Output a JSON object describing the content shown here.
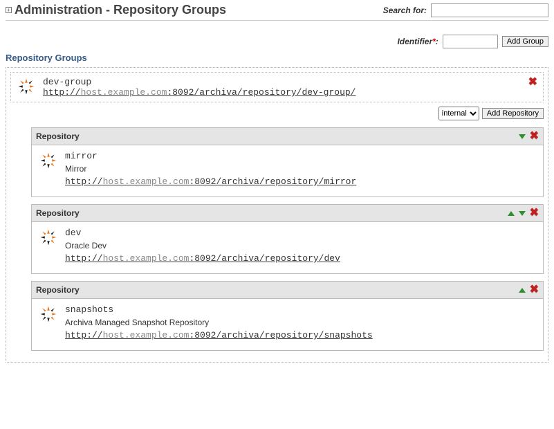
{
  "page": {
    "title": "Administration - Repository Groups",
    "search_label": "Search for:",
    "identifier_label": "Identifier",
    "add_group_btn": "Add Group",
    "section_title": "Repository Groups"
  },
  "group": {
    "id": "dev-group",
    "url_prefix": "http://",
    "url_host": "host.example.com",
    "url_suffix": ":8092/archiva/repository/dev-group/",
    "repo_select_value": "internal",
    "add_repo_btn": "Add Repository"
  },
  "repositories": [
    {
      "heading": "Repository",
      "id": "mirror",
      "name": "Mirror",
      "url_prefix": "http://",
      "url_host": "host.example.com",
      "url_suffix": ":8092/archiva/repository/mirror",
      "show_up": false,
      "show_down": true
    },
    {
      "heading": "Repository",
      "id": "dev",
      "name": "Oracle Dev",
      "url_prefix": "http://",
      "url_host": "host.example.com",
      "url_suffix": ":8092/archiva/repository/dev",
      "show_up": true,
      "show_down": true
    },
    {
      "heading": "Repository",
      "id": "snapshots",
      "name": "Archiva Managed Snapshot Repository",
      "url_prefix": "http://",
      "url_host": "host.example.com",
      "url_suffix": ":8092/archiva/repository/snapshots",
      "show_up": true,
      "show_down": false
    }
  ]
}
